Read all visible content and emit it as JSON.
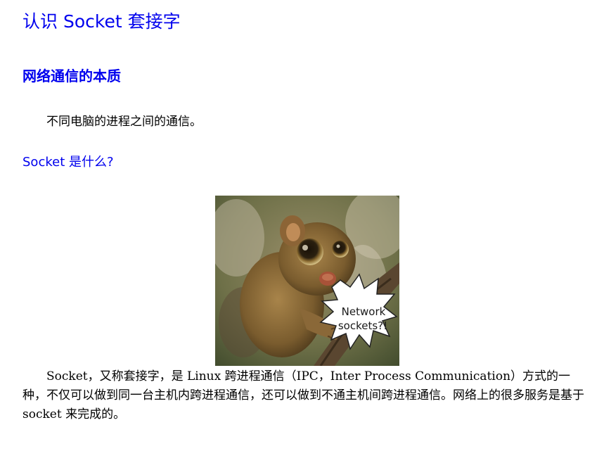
{
  "document": {
    "title": "认识 Socket 套接字",
    "section_heading": "网络通信的本质",
    "section_text": "不同电脑的进程之间的通信。",
    "subsection_heading": "Socket 是什么?",
    "figure": {
      "subject": "tarsier-with-speech-bubble",
      "bubble_line1": "Network",
      "bubble_line2": "sockets?!"
    },
    "body_text": "Socket，又称套接字，是 Linux 跨进程通信（IPC，Inter Process Communication）方式的一种，不仅可以做到同一台主机内跨进程通信，还可以做到不通主机间跨进程通信。网络上的很多服务是基于 socket 来完成的。"
  },
  "colors": {
    "heading": "#0000ee",
    "text": "#000000"
  }
}
